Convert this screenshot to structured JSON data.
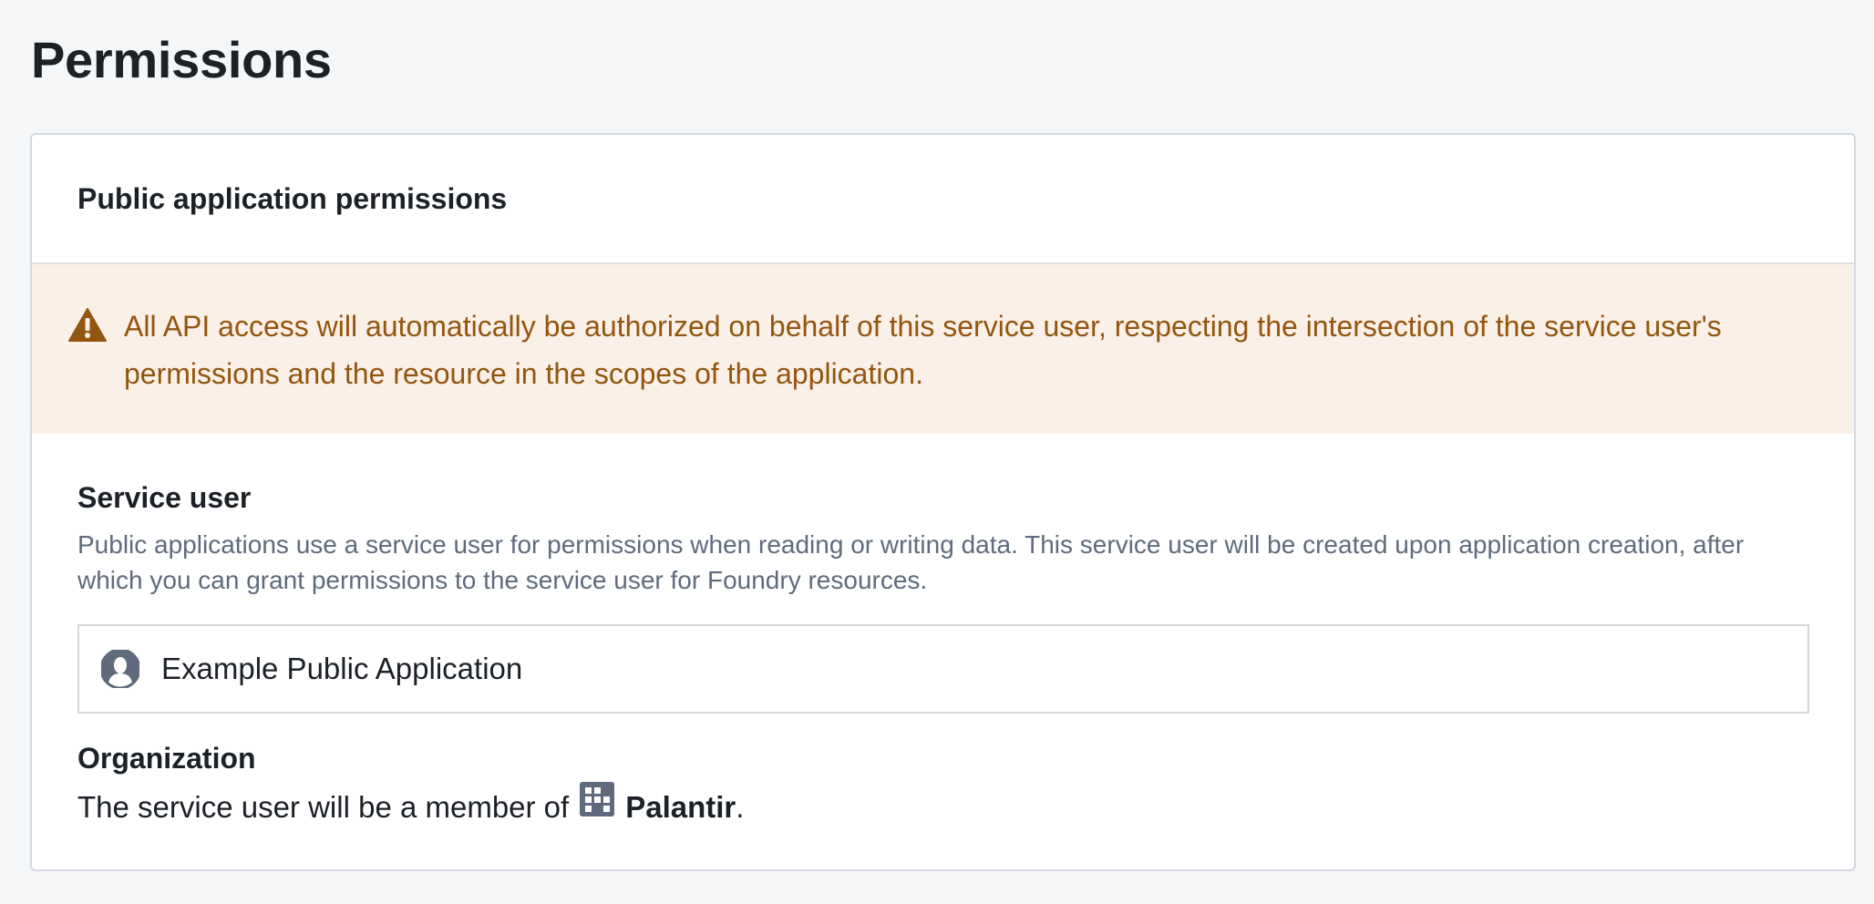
{
  "page": {
    "title": "Permissions"
  },
  "card": {
    "header_title": "Public application permissions",
    "warning": {
      "icon": "warning-triangle-icon",
      "color": "#935610",
      "background": "#fbf0e7",
      "text": "All API access will automatically be authorized on behalf of this service user, respecting the intersection of the service user's permissions and the resource in the scopes of the application."
    },
    "service_user": {
      "title": "Service user",
      "description": "Public applications use a service user for permissions when reading or writing data. This service user will be created upon application creation, after which you can grant permissions to the service user for Foundry resources.",
      "user_icon": "user-avatar-icon",
      "user_name": "Example Public Application"
    },
    "organization": {
      "title": "Organization",
      "text_prefix": "The service user will be a member of",
      "org_icon": "office-building-icon",
      "org_name": "Palantir",
      "text_suffix": "."
    }
  }
}
